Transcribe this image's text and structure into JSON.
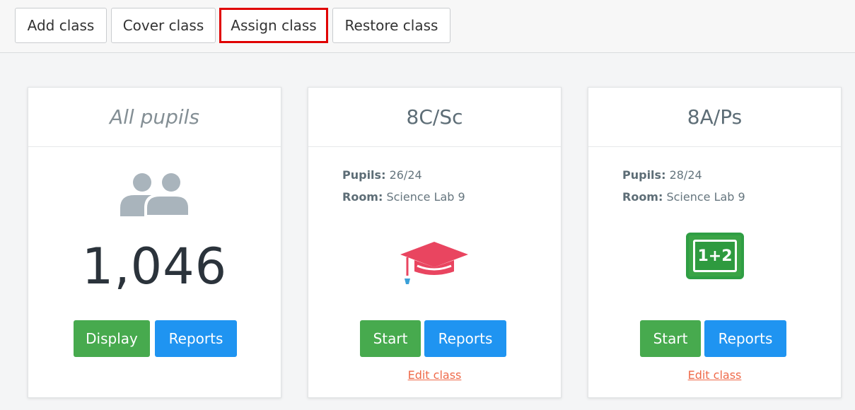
{
  "toolbar": {
    "buttons": [
      {
        "label": "Add class"
      },
      {
        "label": "Cover class"
      },
      {
        "label": "Assign class"
      },
      {
        "label": "Restore class"
      }
    ]
  },
  "cards": [
    {
      "title": "All pupils",
      "icon": "users-icon",
      "count": "1,046",
      "buttons": [
        "Display",
        "Reports"
      ]
    },
    {
      "title": "8C/Sc",
      "pupils_label": "Pupils:",
      "pupils_value": "26/24",
      "room_label": "Room:",
      "room_value": "Science Lab 9",
      "icon": "graduation-cap-icon",
      "buttons": [
        "Start",
        "Reports"
      ],
      "edit_label": "Edit class"
    },
    {
      "title": "8A/Ps",
      "pupils_label": "Pupils:",
      "pupils_value": "28/24",
      "room_label": "Room:",
      "room_value": "Science Lab 9",
      "icon": "chalkboard-math-icon",
      "icon_text": "1+2",
      "buttons": [
        "Start",
        "Reports"
      ],
      "edit_label": "Edit class"
    }
  ],
  "colors": {
    "accent_green": "#47aa4e",
    "accent_blue": "#1f94f1",
    "link_orange": "#ef6a4a",
    "highlight_red": "#e00000"
  }
}
